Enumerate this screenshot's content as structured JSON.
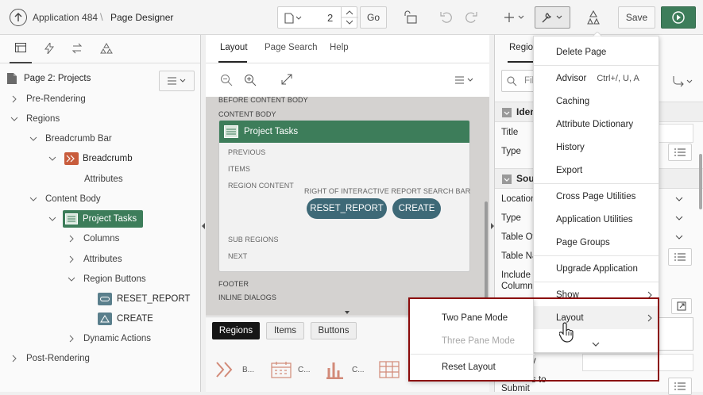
{
  "header": {
    "app_label": "Application 484",
    "separator": "\\",
    "page_title": "Page Designer",
    "page_number": "2",
    "go_label": "Go",
    "save_label": "Save"
  },
  "left": {
    "page_label": "Page 2: Projects",
    "tree": {
      "pre_rendering": "Pre-Rendering",
      "regions": "Regions",
      "breadcrumb_bar": "Breadcrumb Bar",
      "breadcrumb": "Breadcrumb",
      "attributes_1": "Attributes",
      "content_body": "Content Body",
      "project_tasks": "Project Tasks",
      "columns": "Columns",
      "attributes_2": "Attributes",
      "region_buttons": "Region Buttons",
      "reset_report": "RESET_REPORT",
      "create": "CREATE",
      "dynamic_actions": "Dynamic Actions",
      "post_rendering": "Post-Rendering"
    }
  },
  "middle": {
    "tabs": [
      "Layout",
      "Page Search",
      "Help"
    ],
    "before_content_body": "BEFORE CONTENT BODY",
    "content_body": "CONTENT BODY",
    "region_title": "Project Tasks",
    "previous": "PREVIOUS",
    "items": "ITEMS",
    "region_content": "REGION CONTENT",
    "right_of_search": "RIGHT OF INTERACTIVE REPORT SEARCH BAR",
    "btn_reset": "RESET_REPORT",
    "btn_create": "CREATE",
    "sub_regions": "SUB REGIONS",
    "next": "NEXT",
    "footer": "FOOTER",
    "inline_dialogs": "INLINE DIALOGS",
    "gallery_tabs": [
      "Regions",
      "Items",
      "Buttons"
    ],
    "gallery_items": [
      "B...",
      "C...",
      "C..."
    ]
  },
  "right": {
    "tab": "Region",
    "filter_placeholder": "Fil",
    "identification_head": "Iden",
    "title_label": "Title",
    "type_label": "Type",
    "source_head": "Sou",
    "location_label": "Location",
    "type_label_2": "Type",
    "table_owner": "Table Ow",
    "table_name": "Table Na",
    "include_label_1": "Include F",
    "include_label_2": "Column",
    "y_label": "y",
    "submit_label": "Submit",
    "to_label": "s to"
  },
  "menu": {
    "items": [
      "Delete Page",
      "Advisor",
      "Caching",
      "Attribute Dictionary",
      "History",
      "Export",
      "Cross Page Utilities",
      "Application Utilities",
      "Page Groups",
      "Upgrade Application",
      "Show",
      "Layout"
    ],
    "advisor_shortcut": "Ctrl+/, U, A"
  },
  "submenu": {
    "items": [
      "Two Pane Mode",
      "Three Pane Mode",
      "Reset Layout"
    ]
  },
  "colors": {
    "accent_green": "#3d7d5a",
    "pill_teal": "#3e6977",
    "highlight_border": "#8b0b0b",
    "breadcrumb_orange": "#c85c3c"
  }
}
